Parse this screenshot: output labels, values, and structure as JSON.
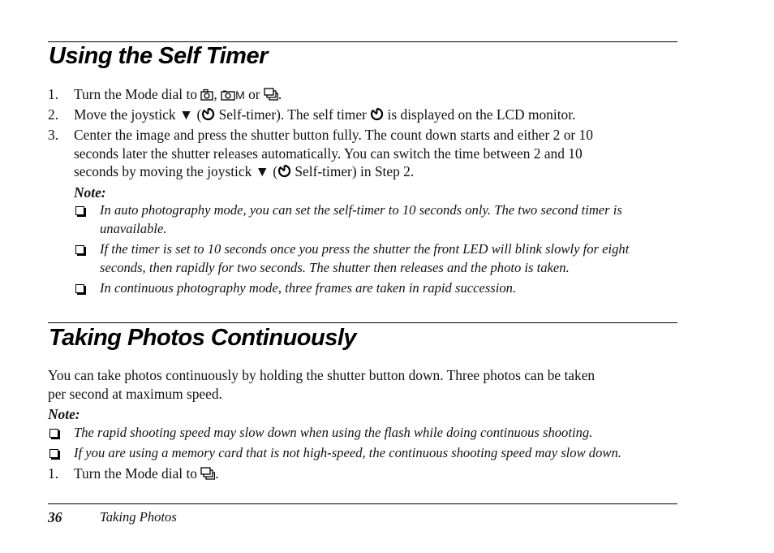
{
  "section1": {
    "title": "Using the Self Timer",
    "steps": [
      {
        "num": "1.",
        "parts": {
          "a": "Turn the Mode dial to ",
          "b": ", ",
          "c": "M",
          "d": " or ",
          "e": "."
        }
      },
      {
        "num": "2.",
        "parts": {
          "a": "Move the joystick ▼ (",
          "b": " Self-timer). The self timer ",
          "c": " is displayed on the LCD monitor."
        }
      },
      {
        "num": "3.",
        "lines": [
          "Center the image and press the shutter button fully. The count down starts and either 2 or 10",
          "seconds later the shutter releases automatically. You can switch the time between 2 and 10"
        ],
        "last": {
          "a": "seconds by moving the joystick ▼ (",
          "b": " Self-timer) in Step 2."
        }
      }
    ],
    "note_label": "Note:",
    "notes": [
      [
        "In auto photography mode, you can set the self-timer to 10 seconds only. The two second timer is",
        "unavailable."
      ],
      [
        "If the timer is set to 10 seconds once you press the shutter the front LED will blink slowly for eight",
        "seconds, then rapidly for two seconds. The shutter then releases and the photo is taken."
      ],
      [
        "In continuous photography mode, three frames are taken in rapid succession."
      ]
    ]
  },
  "section2": {
    "title": "Taking Photos Continuously",
    "body": [
      "You can take photos continuously by holding the shutter button down. Three photos can be taken",
      "per second at maximum speed."
    ],
    "note_label": "Note:",
    "notes": [
      "The rapid shooting speed may slow down when using the flash while doing continuous shooting.",
      "If you are using a memory card that is not high-speed, the continuous shooting speed may slow down."
    ],
    "step": {
      "num": "1.",
      "a": "Turn the Mode dial to ",
      "b": "."
    }
  },
  "icons": {
    "auto": "camera-auto-icon",
    "manual": "camera-manual-icon",
    "continuous": "continuous-shooting-icon",
    "timer": "self-timer-icon"
  },
  "footer": {
    "page_number": "36",
    "section": "Taking Photos"
  }
}
